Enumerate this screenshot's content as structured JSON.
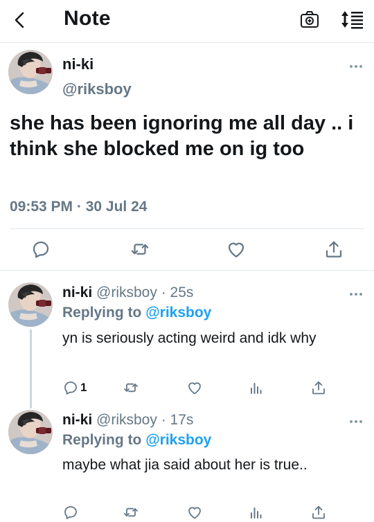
{
  "header": {
    "title": "Note"
  },
  "main_tweet": {
    "name": "ni-ki",
    "handle": "@riksboy",
    "text": "she has been ignoring me all day .. i think she blocked me on ig too",
    "time": "09:53 PM",
    "sep": "·",
    "date": "30 Jul 24"
  },
  "replies": [
    {
      "name": "ni-ki",
      "handle": "@riksboy",
      "sep": "·",
      "time_ago": "25s",
      "replying_prefix": "Replying to",
      "replying_mention": "@riksboy",
      "text": "yn is seriously acting weird and idk why",
      "reply_count": "1"
    },
    {
      "name": "ni-ki",
      "handle": "@riksboy",
      "sep": "·",
      "time_ago": "17s",
      "replying_prefix": "Replying to",
      "replying_mention": "@riksboy",
      "text": "maybe what jia said about her is true.."
    }
  ],
  "icons": {
    "back": "chevron-left-icon",
    "camera": "camera-icon",
    "sort": "sort-icon",
    "more": "more-icon",
    "reply": "reply-icon",
    "retweet": "retweet-icon",
    "like": "heart-icon",
    "share": "share-icon",
    "analytics": "analytics-icon"
  },
  "colors": {
    "accent": "#1da1f2",
    "secondary_text": "#657786",
    "divider": "#e1e8ed"
  }
}
